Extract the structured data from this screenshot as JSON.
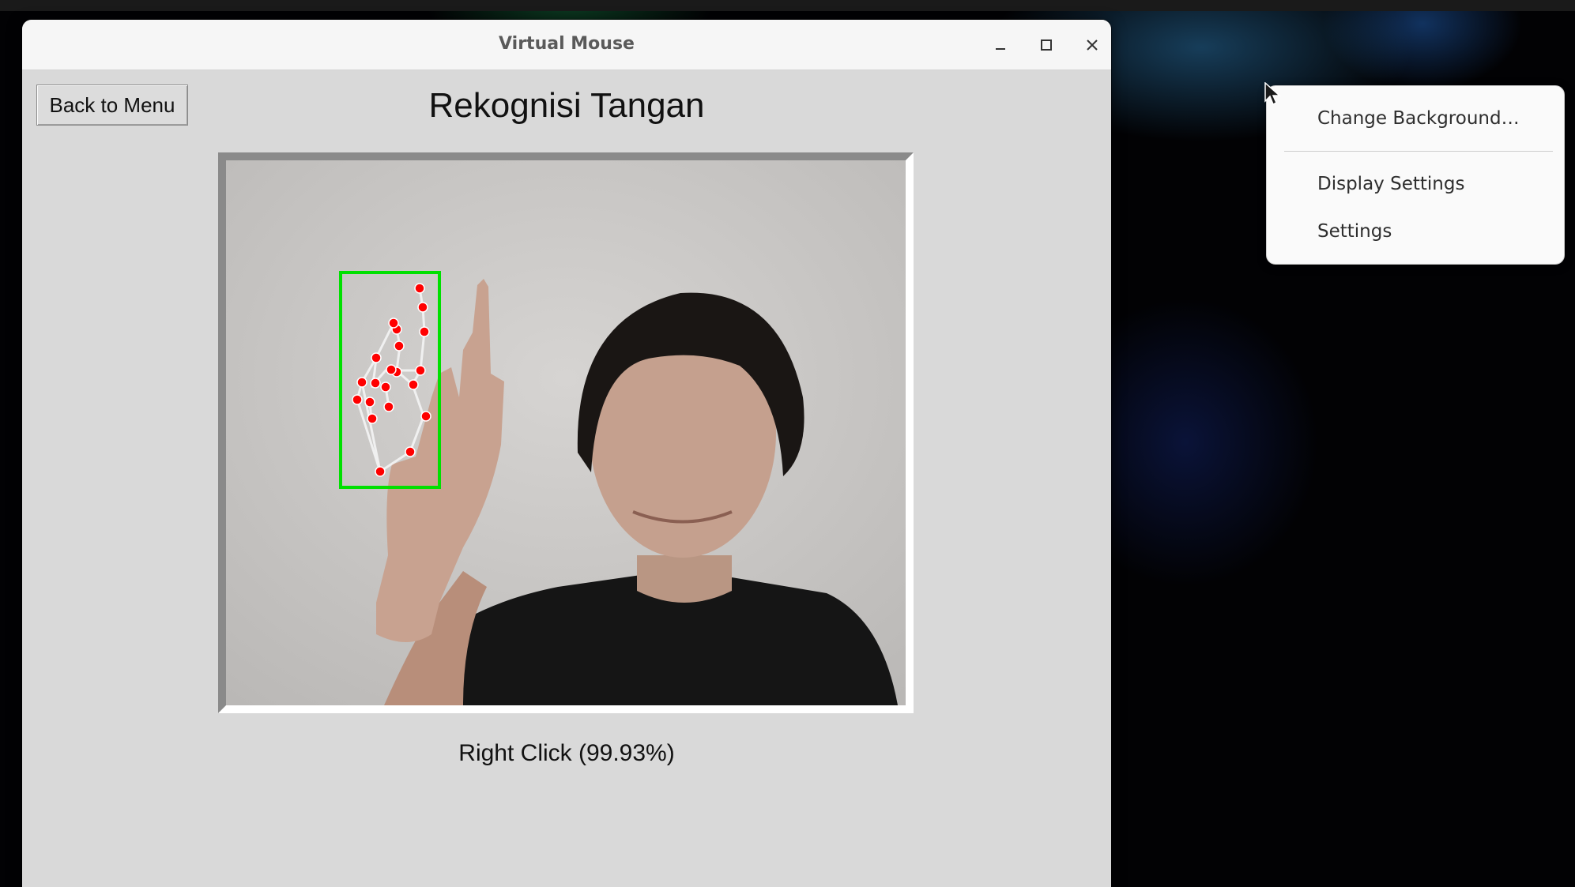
{
  "window": {
    "title": "Virtual Mouse",
    "controls": {
      "minimize": "minimize-icon",
      "maximize": "maximize-icon",
      "close": "close-icon"
    }
  },
  "app": {
    "back_button_label": "Back to Menu",
    "heading": "Rekognisi Tangan",
    "prediction_label": "Right Click (99.93%)",
    "detection_box_color": "#00e000",
    "landmark_color": "#ff0000",
    "skeleton_color": "#f0f0f0"
  },
  "context_menu": {
    "items": [
      {
        "label": "Change Background…"
      },
      {
        "label": "Display Settings"
      },
      {
        "label": "Settings"
      }
    ]
  }
}
